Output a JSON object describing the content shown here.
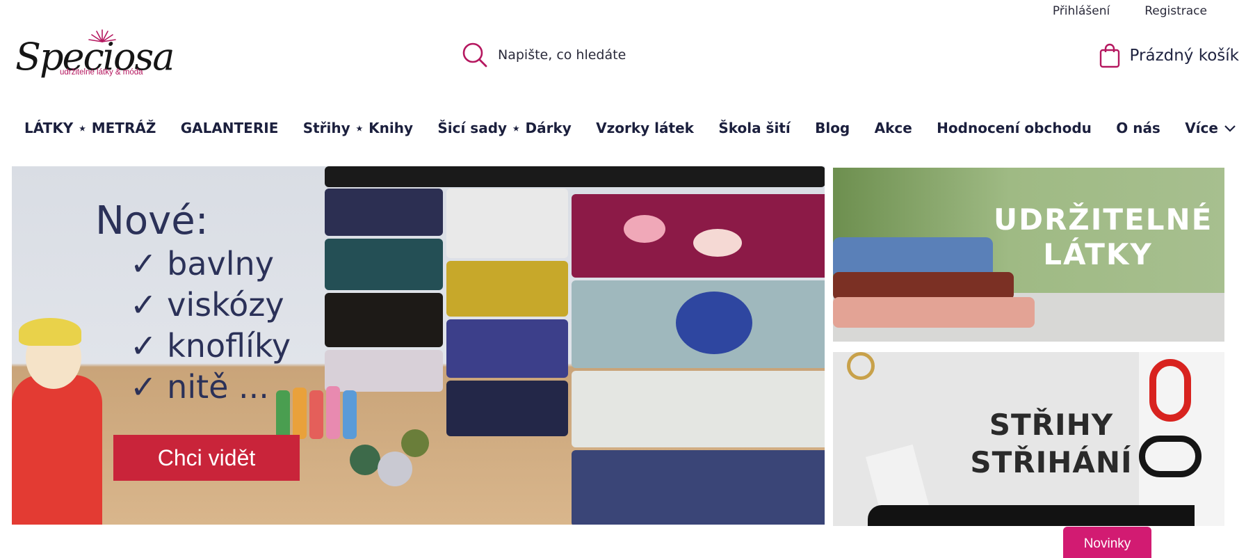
{
  "header": {
    "login_label": "Přihlášení",
    "register_label": "Registrace",
    "logo_text": "Speciosa",
    "logo_tagline": "udržitelné látky & móda",
    "search_placeholder": "Napište, co hledáte",
    "cart_label": "Prázdný košík"
  },
  "nav": {
    "items": [
      {
        "label": "LÁTKY ⋆ METRÁŽ"
      },
      {
        "label": "GALANTERIE"
      },
      {
        "label": "Střihy ⋆ Knihy"
      },
      {
        "label": "Šicí sady ⋆ Dárky"
      },
      {
        "label": "Vzorky látek"
      },
      {
        "label": "Škola šití"
      },
      {
        "label": "Blog"
      },
      {
        "label": "Akce"
      },
      {
        "label": "Hodnocení obchodu"
      },
      {
        "label": "O nás"
      }
    ],
    "more_label": "Více"
  },
  "hero": {
    "headline": "Nové:",
    "bullets": [
      "✓ bavlny",
      "✓ viskózy",
      "✓ knoflíky",
      "✓ nitě ..."
    ],
    "cta_label": "Chci vidět"
  },
  "side_banners": {
    "top_label_line1": "UDRŽITELNÉ",
    "top_label_line2": "LÁTKY",
    "bottom_label_line1": "STŘIHY",
    "bottom_label_line2": "STŘIHÁNÍ"
  },
  "floating": {
    "novinky_label": "Novinky"
  },
  "colors": {
    "brand_pink": "#d21b72",
    "cta_red": "#c9243a",
    "nav_text": "#1b1f3d"
  }
}
